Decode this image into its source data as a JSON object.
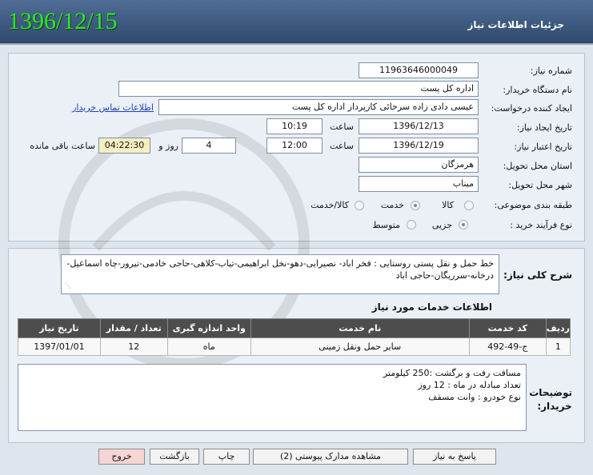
{
  "header": {
    "date": "1396/12/15",
    "title": "جزئیات اطلاعات نیاز"
  },
  "fields": {
    "need_number": {
      "label": "شماره نیاز:",
      "value": "11963646000049"
    },
    "buyer_org": {
      "label": "نام دستگاه خریدار:",
      "value": "اداره کل پست"
    },
    "requester": {
      "label": "ایجاد کننده درخواست:",
      "value": "عیسی دادی زاده سرخائی کارپرداز اداره کل پست",
      "contact_link": "اطلاعات تماس خریدار"
    },
    "created": {
      "label": "تاریخ ایجاد نیاز:",
      "date": "1396/12/13",
      "time_label": "ساعت",
      "time": "10:19"
    },
    "validity": {
      "label": "تاریخ اعتبار نیاز:",
      "date": "1396/12/19",
      "time_label": "ساعت",
      "time": "12:00",
      "days": "4",
      "days_label": "روز و",
      "remaining": "04:22:30",
      "remaining_label": "ساعت باقی مانده"
    },
    "province": {
      "label": "استان محل تحویل:",
      "value": "هرمزگان"
    },
    "city": {
      "label": "شهر محل تحویل:",
      "value": "میناب"
    },
    "category": {
      "label": "طبقه بندی موضوعی:",
      "options": [
        "کالا",
        "خدمت",
        "کالا/خدمت"
      ],
      "selected": "خدمت"
    },
    "process": {
      "label": "نوع فرآیند خرید :",
      "options": [
        "جزیی",
        "متوسط"
      ],
      "selected": "جزیی"
    }
  },
  "summary": {
    "label": "شرح کلی نیاز:",
    "text": "خط حمل و نقل پستی روستایی : فخر اباد- نصیرایی-دهو-نخل ابراهیمی-تیاب-کلاهی-حاجی خادمی-تیرور-چاه اسماعیل-درخانه-سرریگان-حاجی اباد"
  },
  "services": {
    "title": "اطلاعات خدمات مورد نیاز",
    "columns": [
      "ردیف",
      "کد خدمت",
      "نام خدمت",
      "واحد اندازه گیری",
      "تعداد / مقدار",
      "تاریخ نیاز"
    ],
    "rows": [
      [
        "1",
        "ج-49-492",
        "سایر حمل ونقل زمینی",
        "ماه",
        "12",
        "1397/01/01"
      ]
    ]
  },
  "buyer_notes": {
    "label": "توضیحات خریدار:",
    "lines": [
      "مسافت رفت و برگشت :250 کیلومتر",
      "تعداد مبادله در ماه : 12 روز",
      "نوع خودرو : وانت مسقف"
    ]
  },
  "buttons": {
    "reply": "پاسخ به نیاز",
    "attachments": "مشاهده مدارک پیوستی (2)",
    "print": "چاپ",
    "back": "بازگشت",
    "exit": "خروج"
  }
}
